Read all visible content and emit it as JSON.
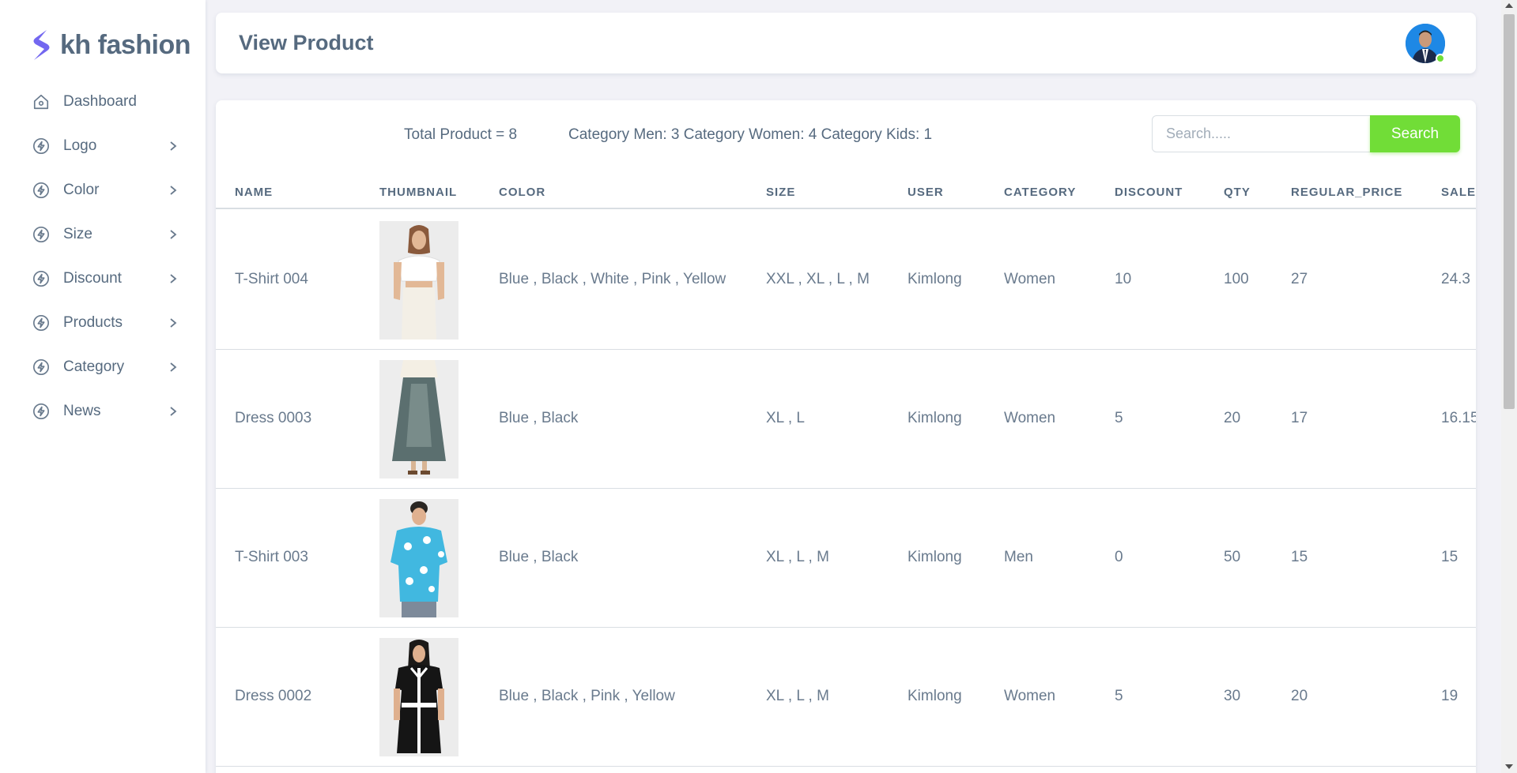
{
  "brand": {
    "name": "kh fashion",
    "logo_color": "#7367f0"
  },
  "sidebar": {
    "items": [
      {
        "label": "Dashboard",
        "icon": "home-icon",
        "has_submenu": false
      },
      {
        "label": "Logo",
        "icon": "bolt-icon",
        "has_submenu": true
      },
      {
        "label": "Color",
        "icon": "bolt-icon",
        "has_submenu": true
      },
      {
        "label": "Size",
        "icon": "bolt-icon",
        "has_submenu": true
      },
      {
        "label": "Discount",
        "icon": "bolt-icon",
        "has_submenu": true
      },
      {
        "label": "Products",
        "icon": "bolt-icon",
        "has_submenu": true
      },
      {
        "label": "Category",
        "icon": "bolt-icon",
        "has_submenu": true
      },
      {
        "label": "News",
        "icon": "bolt-icon",
        "has_submenu": true
      }
    ]
  },
  "header": {
    "title": "View Product",
    "avatar_status": "online"
  },
  "summary": {
    "total": "Total Product = 8",
    "categories": "Category Men: 3 Category Women: 4 Category Kids: 1"
  },
  "search": {
    "placeholder": "Search.....",
    "value": "",
    "button_label": "Search"
  },
  "colors": {
    "accent_green": "#71dd37",
    "text": "#566a7f"
  },
  "table": {
    "columns": [
      "Name",
      "Thumbnail",
      "Color",
      "Size",
      "User",
      "Category",
      "Discount",
      "Qty",
      "Regular_price",
      "Sale"
    ],
    "rows": [
      {
        "name": "T-Shirt 004",
        "thumbnail": "white-crop-tee-photo",
        "color": "Blue , Black , White , Pink , Yellow",
        "size": "XXL , XL , L , M",
        "user": "Kimlong",
        "category": "Women",
        "discount": "10",
        "qty": "100",
        "regular_price": "27",
        "sale": "24.3"
      },
      {
        "name": "Dress 0003",
        "thumbnail": "denim-maxi-skirt-photo",
        "color": "Blue , Black",
        "size": "XL , L",
        "user": "Kimlong",
        "category": "Women",
        "discount": "5",
        "qty": "20",
        "regular_price": "17",
        "sale": "16.15"
      },
      {
        "name": "T-Shirt 003",
        "thumbnail": "floral-blue-shirt-photo",
        "color": "Blue , Black",
        "size": "XL , L , M",
        "user": "Kimlong",
        "category": "Men",
        "discount": "0",
        "qty": "50",
        "regular_price": "15",
        "sale": "15"
      },
      {
        "name": "Dress 0002",
        "thumbnail": "black-white-dress-photo",
        "color": "Blue , Black , Pink , Yellow",
        "size": "XL , L , M",
        "user": "Kimlong",
        "category": "Women",
        "discount": "5",
        "qty": "30",
        "regular_price": "20",
        "sale": "19"
      }
    ]
  }
}
